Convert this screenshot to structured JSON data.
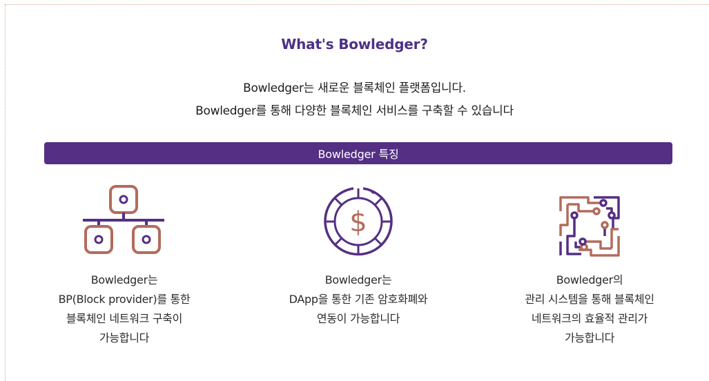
{
  "colors": {
    "purple": "#542f83",
    "heading_purple": "#4f2f86",
    "brown": "#b46b5b"
  },
  "header": {
    "title": "What's Bowledger?",
    "intro_line1": "Bowledger는 새로운 블록체인 플랫폼입니다.",
    "intro_line2": "Bowledger를 통해 다양한 블록체인 서비스를 구축할 수 있습니다"
  },
  "banner": {
    "label": "Bowledger 특징"
  },
  "features": [
    {
      "icon": "network-tree-icon",
      "lines": [
        "Bowledger는",
        "BP(Block provider)를 통한",
        "블록체인 네트워크 구축이",
        "가능합니다"
      ]
    },
    {
      "icon": "dollar-coin-icon",
      "lines": [
        "Bowledger는",
        "DApp을 통한 기존 암호화폐와",
        "연동이 가능합니다"
      ]
    },
    {
      "icon": "circuit-chip-icon",
      "lines": [
        "Bowledger의",
        "관리 시스템을 통해 블록체인",
        "네트워크의 효율적 관리가",
        "가능합니다"
      ]
    }
  ]
}
